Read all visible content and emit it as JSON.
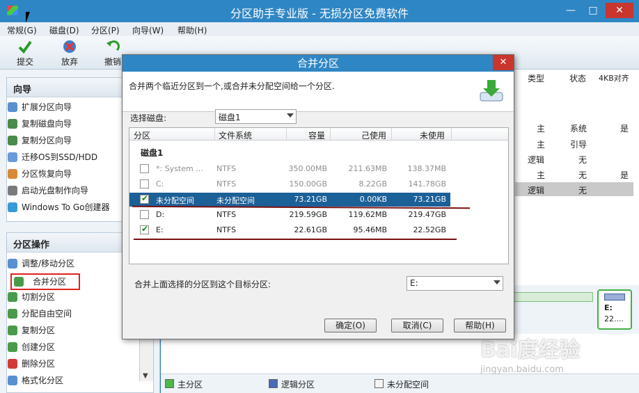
{
  "window": {
    "title": "分区助手专业版 - 无损分区免费软件"
  },
  "menu": [
    "常规(G)",
    "磁盘(D)",
    "分区(P)",
    "向导(W)",
    "帮助(H)"
  ],
  "toolbar": {
    "commit": "提交",
    "discard": "放弃",
    "undo": "撤销"
  },
  "wizard": {
    "title": "向导",
    "items": [
      "扩展分区向导",
      "复制磁盘向导",
      "复制分区向导",
      "迁移OS到SSD/HDD",
      "分区恢复向导",
      "启动光盘制作向导",
      "Windows To Go创建器"
    ]
  },
  "ops": {
    "title": "分区操作",
    "items": [
      "调整/移动分区",
      "合并分区",
      "切割分区",
      "分配自由空间",
      "复制分区",
      "创建分区",
      "删除分区",
      "格式化分区"
    ]
  },
  "right_table": {
    "headers": [
      "类型",
      "状态",
      "4KB对齐"
    ],
    "rows": [
      [
        "主",
        "系统",
        "是"
      ],
      [
        "主",
        "引导",
        ""
      ],
      [
        "逻辑",
        "无",
        ""
      ],
      [
        "主",
        "无",
        "是"
      ],
      [
        "逻辑",
        "无",
        ""
      ]
    ]
  },
  "diskmap": {
    "e_label": "E:",
    "e_size": "22...."
  },
  "legend": {
    "primary": "主分区",
    "logical": "逻辑分区",
    "unalloc": "未分配空间"
  },
  "dialog": {
    "title": "合并分区",
    "description": "合并两个临近分区到一个,或合并未分配空间给一个分区.",
    "select_disk_label": "选择磁盘:",
    "select_disk_value": "磁盘1",
    "table_headers": [
      "分区",
      "文件系统",
      "容量",
      "己使用",
      "未使用"
    ],
    "group_label": "磁盘1",
    "rows": [
      {
        "name": "*: System ...",
        "fs": "NTFS",
        "cap": "350.00MB",
        "used": "211.63MB",
        "free": "138.37MB",
        "checked": false,
        "dim": true
      },
      {
        "name": "C:",
        "fs": "NTFS",
        "cap": "150.00GB",
        "used": "8.22GB",
        "free": "141.78GB",
        "checked": false,
        "dim": true
      },
      {
        "name": "未分配空间",
        "fs": "未分配空间",
        "cap": "73.21GB",
        "used": "0.00KB",
        "free": "73.21GB",
        "checked": true,
        "dim": false
      },
      {
        "name": "D:",
        "fs": "NTFS",
        "cap": "219.59GB",
        "used": "119.62MB",
        "free": "219.47GB",
        "checked": false,
        "dim": false
      },
      {
        "name": "E:",
        "fs": "NTFS",
        "cap": "22.61GB",
        "used": "95.46MB",
        "free": "22.52GB",
        "checked": true,
        "dim": false
      }
    ],
    "target_label": "合并上面选择的分区到这个目标分区:",
    "target_value": "E:",
    "ok": "确定(O)",
    "cancel": "取消(C)",
    "help": "帮助(H)"
  },
  "watermark": {
    "brand": "Bai度经验",
    "url": "jingyan.baidu.com"
  }
}
